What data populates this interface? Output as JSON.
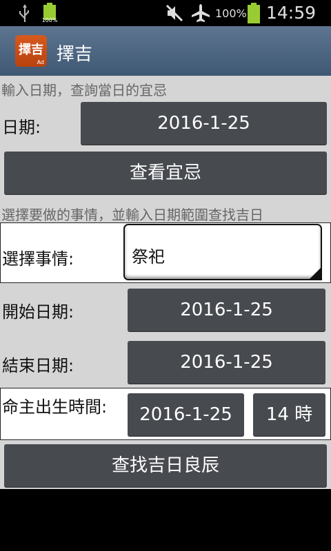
{
  "status_bar": {
    "battery_small_label": "100%",
    "battery_percent": "100%",
    "time": "14:59",
    "icons": [
      "usb-icon",
      "battery-small-icon",
      "mute-icon",
      "airplane-icon",
      "battery-icon"
    ]
  },
  "app": {
    "icon_text": "擇吉",
    "icon_ad": "Ad",
    "title": "擇吉",
    "brand_color": "#c84d16"
  },
  "query_section": {
    "hint": "輸入日期，查詢當日的宜忌",
    "date_label": "日期:",
    "date_value": "2016-1-25",
    "view_button": "查看宜忌"
  },
  "search_section": {
    "hint": "選擇要做的事情，並輸入日期範圍查找吉日",
    "event_label": "選擇事情:",
    "event_value": "祭祀",
    "start_label": "開始日期:",
    "start_value": "2016-1-25",
    "end_label": "結束日期:",
    "end_value": "2016-1-25",
    "birth_label": "命主出生時間:",
    "birth_date": "2016-1-25",
    "birth_hour": "14 時",
    "search_button": "查找吉日良辰"
  }
}
